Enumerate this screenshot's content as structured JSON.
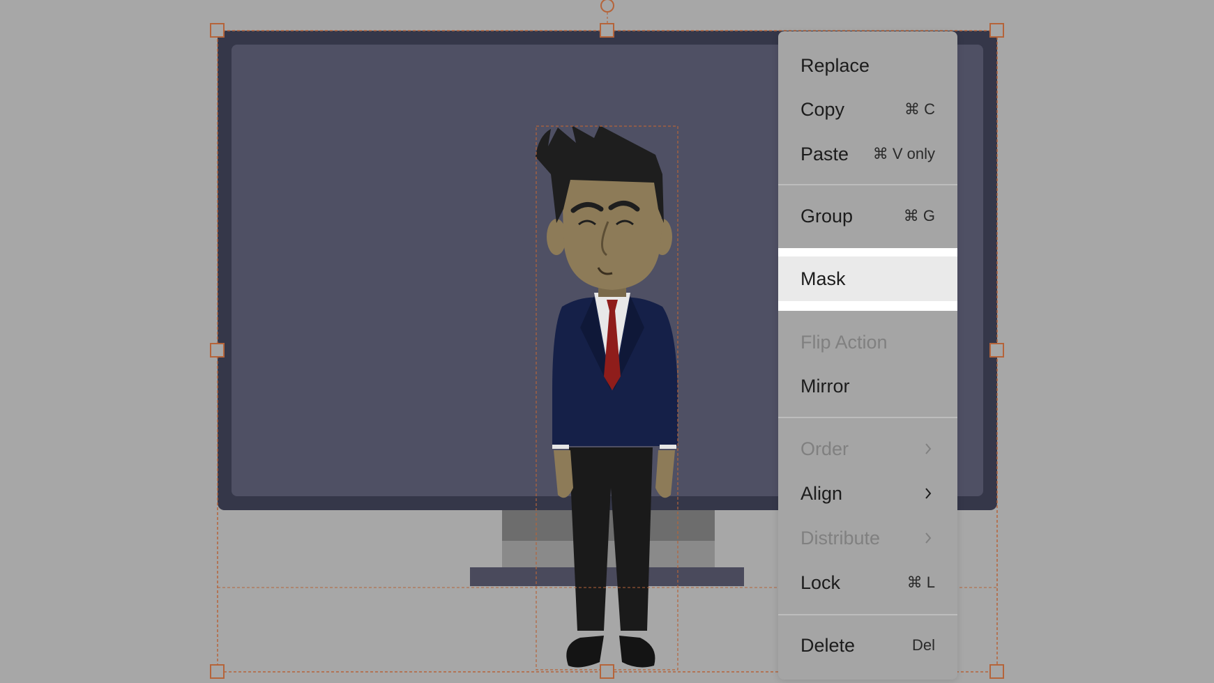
{
  "menu": {
    "items": [
      {
        "label": "Replace",
        "shortcut": "",
        "disabled": false,
        "submenu": false
      },
      {
        "label": "Copy",
        "shortcut": "⌘ C",
        "disabled": false,
        "submenu": false
      },
      {
        "label": "Paste",
        "shortcut": "⌘ V only",
        "disabled": false,
        "submenu": false
      },
      {
        "label": "Group",
        "shortcut": "⌘ G",
        "disabled": false,
        "submenu": false
      },
      {
        "label": "Mask",
        "shortcut": "",
        "disabled": false,
        "submenu": false,
        "active": true
      },
      {
        "label": "Flip Action",
        "shortcut": "",
        "disabled": true,
        "submenu": false
      },
      {
        "label": "Mirror",
        "shortcut": "",
        "disabled": false,
        "submenu": false
      },
      {
        "label": "Order",
        "shortcut": "",
        "disabled": true,
        "submenu": true
      },
      {
        "label": "Align",
        "shortcut": "",
        "disabled": false,
        "submenu": true
      },
      {
        "label": "Distribute",
        "shortcut": "",
        "disabled": true,
        "submenu": true
      },
      {
        "label": "Lock",
        "shortcut": "⌘ L",
        "disabled": false,
        "submenu": false
      },
      {
        "label": "Delete",
        "shortcut": "Del",
        "disabled": false,
        "submenu": false
      }
    ]
  },
  "colors": {
    "canvas_bg": "#a7a7a7",
    "selection": "#b5643a",
    "monitor_frame": "#353749",
    "monitor_screen": "#4f5064",
    "suit": "#152048",
    "tie": "#8f1d1b",
    "skin": "#8d7b58",
    "hair": "#1e1e1e"
  }
}
